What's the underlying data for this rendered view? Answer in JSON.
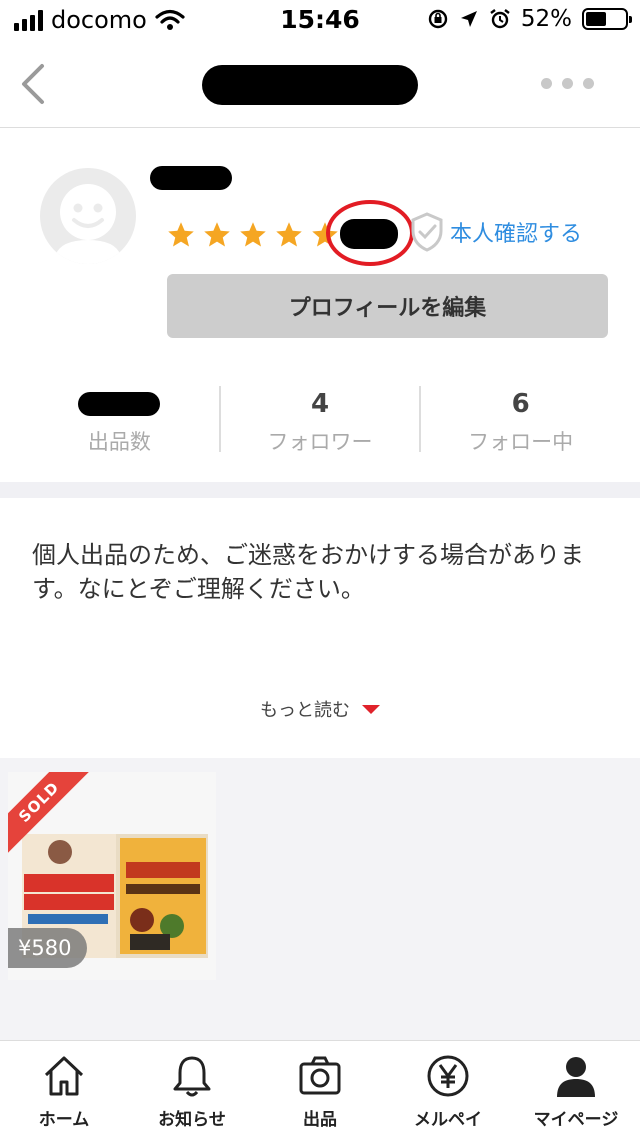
{
  "status_bar": {
    "carrier": "docomo",
    "time": "15:46",
    "battery": "52%",
    "battery_level": 0.52
  },
  "profile": {
    "rating_stars": 5,
    "verify_label": "本人確認する",
    "edit_button_label": "プロフィールを編集"
  },
  "stats": [
    {
      "value": "",
      "label": "出品数"
    },
    {
      "value": "4",
      "label": "フォロワー"
    },
    {
      "value": "6",
      "label": "フォロー中"
    }
  ],
  "bio": {
    "text": "個人出品のため、ご迷惑をおかけする場合があります。なにとぞご理解ください。",
    "read_more_label": "もっと読む"
  },
  "items": [
    {
      "badge": "SOLD",
      "price": "¥580"
    }
  ],
  "tab_bar": [
    {
      "label": "ホーム",
      "icon": "home-icon"
    },
    {
      "label": "お知らせ",
      "icon": "bell-icon"
    },
    {
      "label": "出品",
      "icon": "camera-icon"
    },
    {
      "label": "メルペイ",
      "icon": "yen-icon"
    },
    {
      "label": "マイページ",
      "icon": "person-icon"
    }
  ],
  "colors": {
    "accent_blue": "#2f8de0",
    "star": "#f5a623",
    "sold_red": "#e5433b",
    "annotation_red": "#e21c24"
  }
}
